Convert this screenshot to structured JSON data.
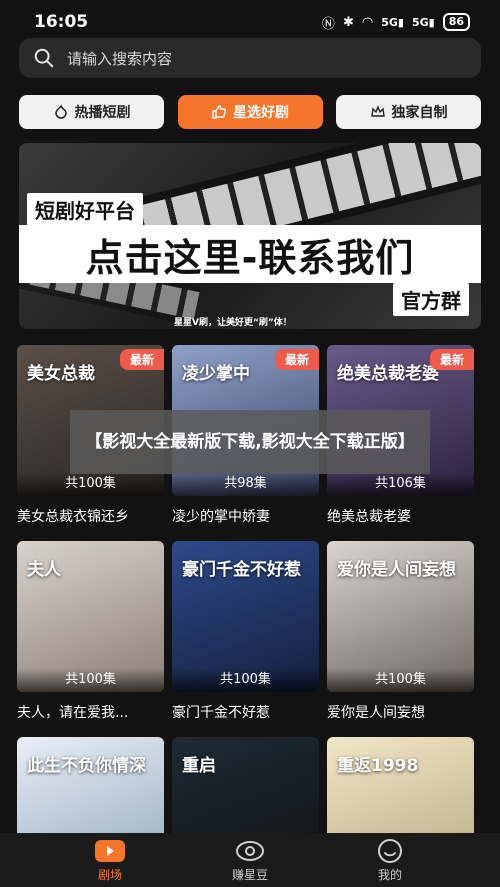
{
  "status": {
    "time": "16:05",
    "signal1": "5G",
    "signal2": "5G",
    "battery": "86"
  },
  "search": {
    "placeholder": "请输入搜索内容"
  },
  "tabs": [
    {
      "label": "热播短剧",
      "icon": "flame-icon"
    },
    {
      "label": "星选好剧",
      "icon": "thumbs-up-icon"
    },
    {
      "label": "独家自制",
      "icon": "crown-icon"
    }
  ],
  "banner": {
    "tag1": "短剧好平台",
    "headline": "点击这里-联系我们",
    "tag2": "官方群",
    "slogan": "星星V刷，让美好更“刷”体！"
  },
  "overlay": {
    "text": "【影视大全最新版下载,影视大全下载正版】"
  },
  "new_badge": "最新",
  "dramas": [
    {
      "title": "美女总裁衣锦还乡",
      "episodes": "共100集",
      "is_new": true,
      "poster_text": "美女总裁",
      "poster_colors": [
        "#5a5048",
        "#2a2522"
      ]
    },
    {
      "title": "凌少的掌中娇妻",
      "episodes": "共98集",
      "is_new": true,
      "poster_text": "凌少掌中",
      "poster_colors": [
        "#8fa0c8",
        "#3c4468"
      ]
    },
    {
      "title": "绝美总裁老婆",
      "episodes": "共106集",
      "is_new": true,
      "poster_text": "绝美总裁老婆",
      "poster_colors": [
        "#6a5a8a",
        "#2b2240"
      ]
    },
    {
      "title": "夫人，请在爱我...",
      "episodes": "共100集",
      "is_new": false,
      "poster_text": "夫人",
      "poster_colors": [
        "#d8d2cc",
        "#8c7f76"
      ]
    },
    {
      "title": "豪门千金不好惹",
      "episodes": "共100集",
      "is_new": false,
      "poster_text": "豪门千金不好惹",
      "poster_colors": [
        "#2d4a8a",
        "#141f3d"
      ]
    },
    {
      "title": "爱你是人间妄想",
      "episodes": "共100集",
      "is_new": false,
      "poster_text": "爱你是人间妄想",
      "poster_colors": [
        "#d9d4cf",
        "#6e6660"
      ]
    },
    {
      "title": "",
      "episodes": "",
      "is_new": false,
      "poster_text": "此生不负你情深",
      "poster_colors": [
        "#e8eef5",
        "#8fa5bd"
      ]
    },
    {
      "title": "",
      "episodes": "",
      "is_new": false,
      "poster_text": "重启",
      "poster_colors": [
        "#1f2a33",
        "#0d1216"
      ]
    },
    {
      "title": "",
      "episodes": "",
      "is_new": false,
      "poster_text": "重返1998",
      "poster_colors": [
        "#f1e6c8",
        "#b7a77f"
      ]
    }
  ],
  "bottom_nav": [
    {
      "label": "剧场",
      "icon": "theater-icon",
      "active": true
    },
    {
      "label": "赚星豆",
      "icon": "eye-coin-icon",
      "active": false
    },
    {
      "label": "我的",
      "icon": "profile-icon",
      "active": false
    }
  ]
}
